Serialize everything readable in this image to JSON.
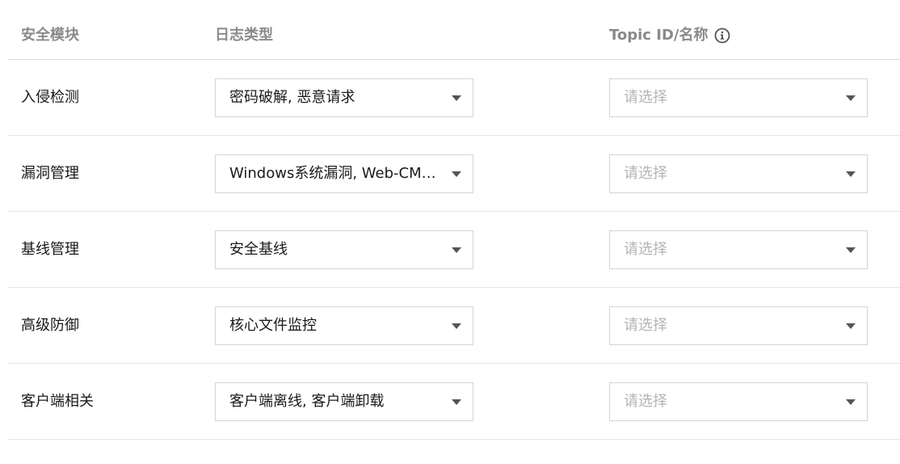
{
  "header": {
    "module_label": "安全模块",
    "logtype_label": "日志类型",
    "topic_label": "Topic ID/名称"
  },
  "rows": [
    {
      "module": "入侵检测",
      "logtype": "密码破解, 恶意请求",
      "topic_placeholder": "请选择"
    },
    {
      "module": "漏洞管理",
      "logtype": "Windows系统漏洞, Web-CMS漏洞",
      "topic_placeholder": "请选择"
    },
    {
      "module": "基线管理",
      "logtype": "安全基线",
      "topic_placeholder": "请选择"
    },
    {
      "module": "高级防御",
      "logtype": "核心文件监控",
      "topic_placeholder": "请选择"
    },
    {
      "module": "客户端相关",
      "logtype": "客户端离线, 客户端卸载",
      "topic_placeholder": "请选择"
    }
  ]
}
